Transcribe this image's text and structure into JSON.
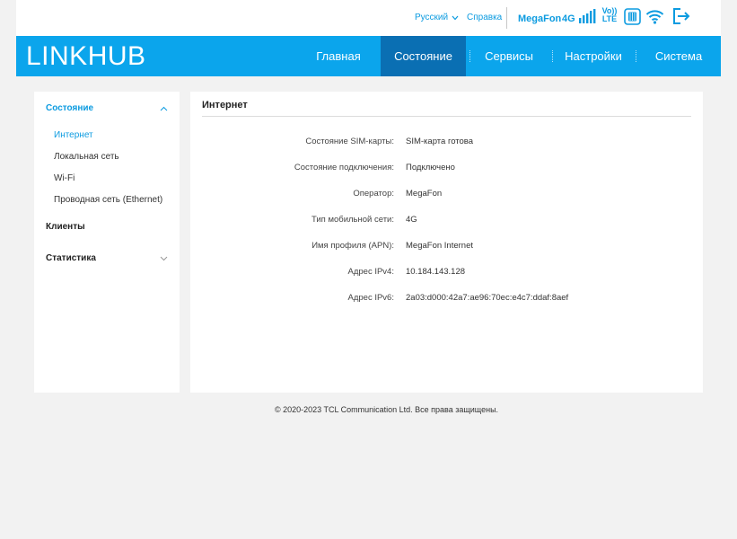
{
  "topbar": {
    "language": "Русский",
    "help": "Справка",
    "operator": "MegaFon",
    "network_type": "4G",
    "volte_line1": "Vo))",
    "volte_line2": "LTE",
    "accent_color": "#0c9be0"
  },
  "navbar": {
    "logo_part1": "LINK",
    "logo_part2": "HUB",
    "items": [
      {
        "label": "Главная"
      },
      {
        "label": "Состояние",
        "active": true
      },
      {
        "label": "Сервисы"
      },
      {
        "label": "Настройки"
      },
      {
        "label": "Система"
      }
    ],
    "bg_color": "#0ba5ec",
    "active_color": "#0a6fb3"
  },
  "sidebar": {
    "sections": [
      {
        "label": "Состояние",
        "expanded": true,
        "items": [
          "Интернет",
          "Локальная сеть",
          "Wi-Fi",
          "Проводная сеть (Ethernet)"
        ]
      },
      {
        "label": "Клиенты"
      },
      {
        "label": "Статистика",
        "expanded": false
      }
    ]
  },
  "content": {
    "title": "Интернет",
    "rows": [
      {
        "label": "Состояние SIM-карты:",
        "value": "SIM-карта готова"
      },
      {
        "label": "Состояние подключения:",
        "value": "Подключено"
      },
      {
        "label": "Оператор:",
        "value": "MegaFon"
      },
      {
        "label": "Тип мобильной сети:",
        "value": "4G"
      },
      {
        "label": "Имя профиля (APN):",
        "value": "MegaFon Internet"
      },
      {
        "label": "Адрес IPv4:",
        "value": "10.184.143.128"
      },
      {
        "label": "Адрес IPv6:",
        "value": "2a03:d000:42a7:ae96:70ec:e4c7:ddaf:8aef"
      }
    ]
  },
  "footer": {
    "copyright": "© 2020-2023 TCL Communication Ltd. Все права защищены."
  }
}
